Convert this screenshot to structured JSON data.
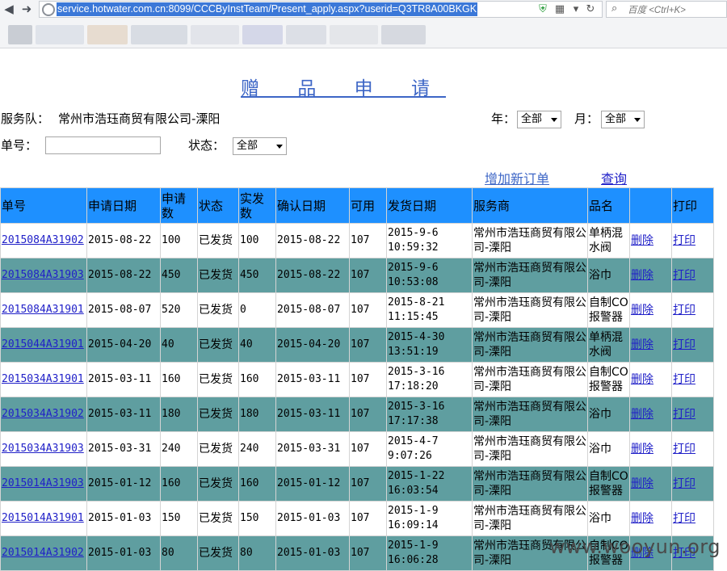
{
  "browser": {
    "url": "service.hotwater.com.cn:8099/CCCByInstTeam/Present_apply.aspx?userid=Q3TR8A00BKGK",
    "search_placeholder": "百度 <Ctrl+K>"
  },
  "page": {
    "title": "赠 品 申 请",
    "service_team_label": "服务队：",
    "service_team_value": "常州市浩珏商贸有限公司-溧阳",
    "year_label": "年：",
    "year_value": "全部",
    "month_label": "月：",
    "month_value": "全部",
    "order_no_label": "单号：",
    "order_no_value": "",
    "status_label": "状态：",
    "status_value": "全部",
    "add_order_link": "增加新订单",
    "query_link": "查询"
  },
  "table": {
    "headers": [
      "单号",
      "申请日期",
      "申请数",
      "状态",
      "实发数",
      "确认日期",
      "可用",
      "发货日期",
      "服务商",
      "品名",
      "",
      "打印"
    ],
    "rows": [
      {
        "id": "2015084A31902",
        "apply_date": "2015-08-22",
        "qty": "100",
        "status": "已发货",
        "sent": "100",
        "confirm_date": "2015-08-22",
        "avail": "107",
        "ship_date": "2015-9-6",
        "ship_time": "10:59:32",
        "provider": "常州市浩珏商贸有限公司-溧阳",
        "product": "单柄混水阀",
        "delete": "删除",
        "print": "打印"
      },
      {
        "id": "2015084A31903",
        "apply_date": "2015-08-22",
        "qty": "450",
        "status": "已发货",
        "sent": "450",
        "confirm_date": "2015-08-22",
        "avail": "107",
        "ship_date": "2015-9-6",
        "ship_time": "10:53:08",
        "provider": "常州市浩珏商贸有限公司-溧阳",
        "product": "浴巾",
        "delete": "删除",
        "print": "打印"
      },
      {
        "id": "2015084A31901",
        "apply_date": "2015-08-07",
        "qty": "520",
        "status": "已发货",
        "sent": "0",
        "confirm_date": "2015-08-07",
        "avail": "107",
        "ship_date": "2015-8-21",
        "ship_time": "11:15:45",
        "provider": "常州市浩珏商贸有限公司-溧阳",
        "product": "自制CO报警器",
        "delete": "删除",
        "print": "打印"
      },
      {
        "id": "2015044A31901",
        "apply_date": "2015-04-20",
        "qty": "40",
        "status": "已发货",
        "sent": "40",
        "confirm_date": "2015-04-20",
        "avail": "107",
        "ship_date": "2015-4-30",
        "ship_time": "13:51:19",
        "provider": "常州市浩珏商贸有限公司-溧阳",
        "product": "单柄混水阀",
        "delete": "删除",
        "print": "打印"
      },
      {
        "id": "2015034A31901",
        "apply_date": "2015-03-11",
        "qty": "160",
        "status": "已发货",
        "sent": "160",
        "confirm_date": "2015-03-11",
        "avail": "107",
        "ship_date": "2015-3-16",
        "ship_time": "17:18:20",
        "provider": "常州市浩珏商贸有限公司-溧阳",
        "product": "自制CO报警器",
        "delete": "删除",
        "print": "打印"
      },
      {
        "id": "2015034A31902",
        "apply_date": "2015-03-11",
        "qty": "180",
        "status": "已发货",
        "sent": "180",
        "confirm_date": "2015-03-11",
        "avail": "107",
        "ship_date": "2015-3-16",
        "ship_time": "17:17:38",
        "provider": "常州市浩珏商贸有限公司-溧阳",
        "product": "浴巾",
        "delete": "删除",
        "print": "打印"
      },
      {
        "id": "2015034A31903",
        "apply_date": "2015-03-31",
        "qty": "240",
        "status": "已发货",
        "sent": "240",
        "confirm_date": "2015-03-31",
        "avail": "107",
        "ship_date": "2015-4-7",
        "ship_time": "9:07:26",
        "provider": "常州市浩珏商贸有限公司-溧阳",
        "product": "浴巾",
        "delete": "删除",
        "print": "打印"
      },
      {
        "id": "2015014A31903",
        "apply_date": "2015-01-12",
        "qty": "160",
        "status": "已发货",
        "sent": "160",
        "confirm_date": "2015-01-12",
        "avail": "107",
        "ship_date": "2015-1-22",
        "ship_time": "16:03:54",
        "provider": "常州市浩珏商贸有限公司-溧阳",
        "product": "自制CO报警器",
        "delete": "删除",
        "print": "打印"
      },
      {
        "id": "2015014A31901",
        "apply_date": "2015-01-03",
        "qty": "150",
        "status": "已发货",
        "sent": "150",
        "confirm_date": "2015-01-03",
        "avail": "107",
        "ship_date": "2015-1-9",
        "ship_time": "16:09:14",
        "provider": "常州市浩珏商贸有限公司-溧阳",
        "product": "浴巾",
        "delete": "删除",
        "print": "打印"
      },
      {
        "id": "2015014A31902",
        "apply_date": "2015-01-03",
        "qty": "80",
        "status": "已发货",
        "sent": "80",
        "confirm_date": "2015-01-03",
        "avail": "107",
        "ship_date": "2015-1-9",
        "ship_time": "16:06:28",
        "provider": "常州市浩珏商贸有限公司-溧阳",
        "product": "自制CO报警器",
        "delete": "删除",
        "print": "打印"
      }
    ]
  },
  "watermark": "www.wooyun.org",
  "colors": {
    "header_bg": "#1e90ff",
    "alt_row_bg": "#5f9ea0",
    "link": "#2020c8",
    "title": "#3d66c6"
  }
}
